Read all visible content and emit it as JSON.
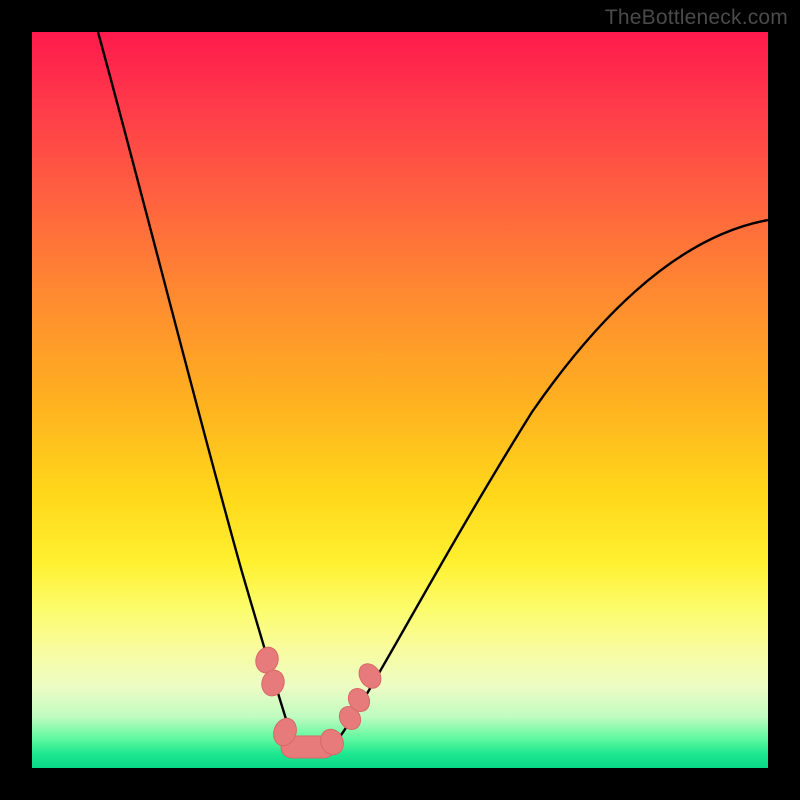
{
  "watermark": "TheBottleneck.com",
  "chart_data": {
    "type": "line",
    "title": "",
    "xlabel": "",
    "ylabel": "",
    "xlim": [
      0,
      100
    ],
    "ylim": [
      0,
      100
    ],
    "background_gradient_meaning": "vertical performance heatmap (red=high bottleneck, green=low bottleneck)",
    "series": [
      {
        "name": "bottleneck-curve-left",
        "x": [
          9,
          12,
          15,
          18,
          21,
          24,
          26,
          28,
          30,
          32,
          33.5,
          35
        ],
        "y": [
          100,
          86,
          72,
          58,
          45,
          33,
          25,
          18,
          12,
          7,
          4,
          2
        ]
      },
      {
        "name": "bottleneck-curve-right",
        "x": [
          40,
          42,
          45,
          50,
          56,
          63,
          71,
          80,
          90,
          100
        ],
        "y": [
          2,
          5,
          10,
          18,
          28,
          39,
          50,
          60,
          68,
          74
        ]
      }
    ],
    "markers": [
      {
        "name": "left-cluster",
        "points": [
          {
            "x": 32.0,
            "y": 14.5
          },
          {
            "x": 32.8,
            "y": 11.5
          },
          {
            "x": 34.2,
            "y": 4.0
          },
          {
            "x": 36.0,
            "y": 2.0
          },
          {
            "x": 38.0,
            "y": 1.5
          },
          {
            "x": 40.0,
            "y": 1.5
          }
        ]
      },
      {
        "name": "right-cluster",
        "points": [
          {
            "x": 43.5,
            "y": 6.5
          },
          {
            "x": 44.4,
            "y": 9.0
          },
          {
            "x": 45.8,
            "y": 12.5
          }
        ]
      }
    ],
    "marker_style": {
      "color": "#e77b7b",
      "radius_px": 10
    }
  }
}
